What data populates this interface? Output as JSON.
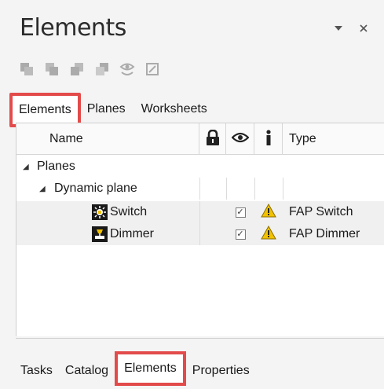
{
  "panel": {
    "title": "Elements",
    "controls": [
      {
        "name": "dropdown-arrow-icon",
        "glyph": "▾"
      },
      {
        "name": "close-icon",
        "glyph": "×"
      }
    ]
  },
  "toolbar": {
    "buttons": [
      {
        "name": "bring-to-front-icon"
      },
      {
        "name": "bring-forward-icon"
      },
      {
        "name": "send-backward-icon"
      },
      {
        "name": "send-to-back-icon"
      },
      {
        "name": "visibility-toggle-icon"
      },
      {
        "name": "edit-properties-icon"
      }
    ]
  },
  "top_tabs": [
    {
      "label": "Elements",
      "active": true
    },
    {
      "label": "Planes",
      "active": false
    },
    {
      "label": "Worksheets",
      "active": false
    }
  ],
  "grid": {
    "headers": {
      "name": "Name",
      "lock_icon": "lock-icon",
      "eye_icon": "eye-icon",
      "info_icon": "info-icon",
      "type": "Type"
    },
    "rows": [
      {
        "label": "Planes",
        "level": 0,
        "expander": "◢",
        "type": "",
        "checked": false,
        "warning": false
      },
      {
        "label": "Dynamic plane",
        "level": 1,
        "expander": "◢",
        "type": "",
        "checked": false,
        "warning": false
      },
      {
        "label": "Switch",
        "level": 2,
        "icon": "switch-element-icon",
        "type": "FAP Switch",
        "checked": true,
        "warning": true
      },
      {
        "label": "Dimmer",
        "level": 2,
        "icon": "dimmer-element-icon",
        "type": "FAP Dimmer",
        "checked": true,
        "warning": true
      }
    ]
  },
  "bottom_tabs": [
    {
      "label": "Tasks",
      "active": false
    },
    {
      "label": "Catalog",
      "active": false
    },
    {
      "label": "Elements",
      "active": true
    },
    {
      "label": "Properties",
      "active": false
    }
  ],
  "colors": {
    "accent_red": "#e34b4b",
    "warning_yellow": "#f2c200",
    "icon_dark": "#3a3a3a"
  }
}
